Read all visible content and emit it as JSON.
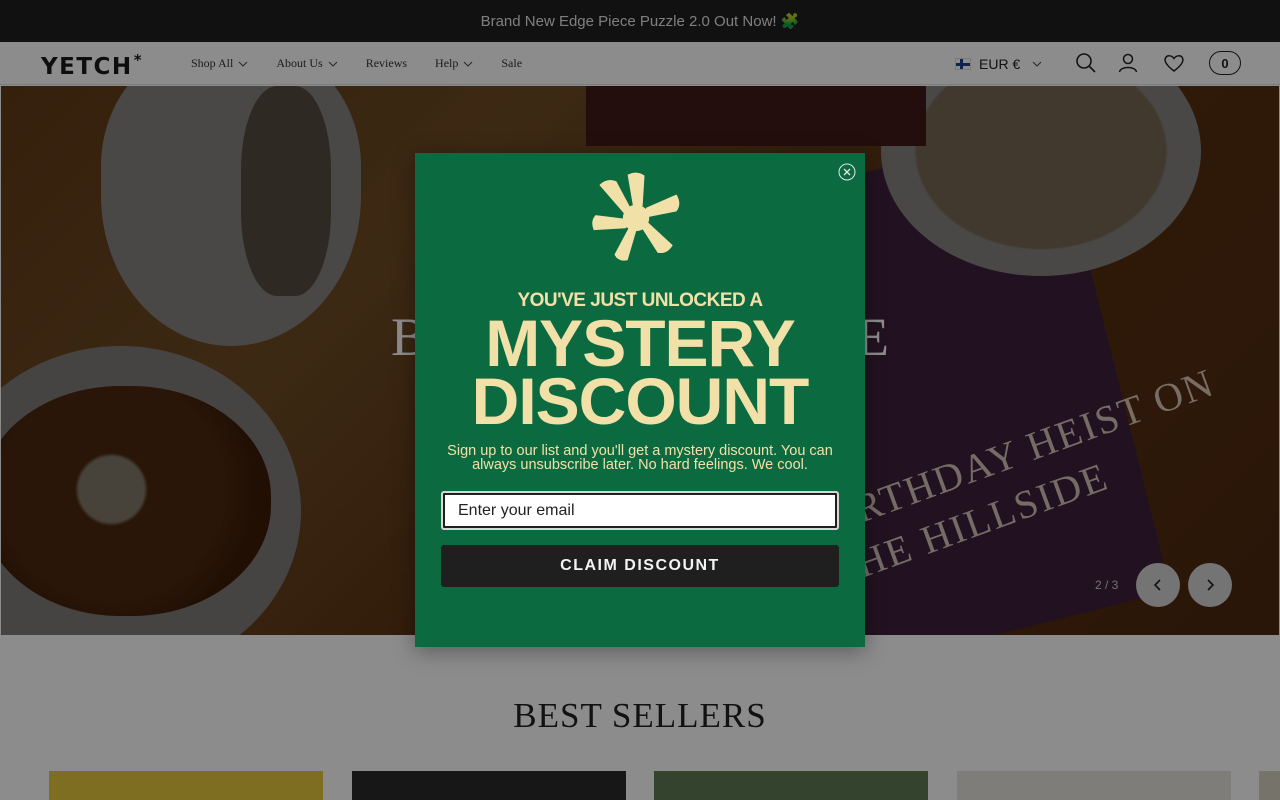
{
  "announcement": {
    "text": "Brand New Edge Piece Puzzle 2.0 Out Now! 🧩"
  },
  "header": {
    "logo": "YETCH",
    "logo_mark": "*",
    "nav": [
      {
        "label": "Shop All",
        "has_dropdown": true
      },
      {
        "label": "About Us",
        "has_dropdown": true
      },
      {
        "label": "Reviews",
        "has_dropdown": false
      },
      {
        "label": "Help",
        "has_dropdown": true
      },
      {
        "label": "Sale",
        "has_dropdown": false
      }
    ],
    "currency": "EUR €",
    "cart_count": "0",
    "icons": [
      "search-icon",
      "account-icon",
      "wishlist-heart-icon"
    ]
  },
  "hero": {
    "headline": "BIRTHDAY HEIST ON THE HILLSIDE",
    "visible_headline_left": "B",
    "visible_headline_right": "E",
    "box_text": "BIRTHDAY HEIST ON\nTHE HILLSIDE",
    "slide_indicator": "2 / 3"
  },
  "best_sellers": {
    "title": "BEST SELLERS"
  },
  "popup": {
    "unlock_text": "YOU'VE JUST UNLOCKED A",
    "headline_line1": "MYSTERY",
    "headline_line2": "DISCOUNT",
    "subtext": "Sign up to our list and you'll get a mystery discount. You can always unsubscribe later. No hard feelings. We cool.",
    "email_placeholder": "Enter your email",
    "button_label": "CLAIM DISCOUNT"
  },
  "colors": {
    "popup_bg": "#0b6a40",
    "popup_text": "#f1e1a8",
    "announcement_bg": "#1f1f1f",
    "button_bg": "#1f1f1f"
  }
}
